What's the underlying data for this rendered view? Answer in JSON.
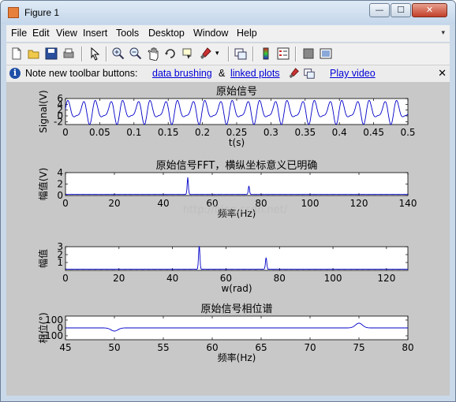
{
  "window": {
    "title": "Figure 1"
  },
  "caption_buttons": {
    "minimize": "—",
    "maximize": "☐",
    "close": "✕"
  },
  "menu": [
    "File",
    "Edit",
    "View",
    "Insert",
    "Tools",
    "Desktop",
    "Window",
    "Help"
  ],
  "toolbar_icons": [
    "new-figure-icon",
    "open-file-icon",
    "save-icon",
    "print-icon",
    "pointer-icon",
    "zoom-in-icon",
    "zoom-out-icon",
    "pan-icon",
    "rotate-3d-icon",
    "data-cursor-icon",
    "brush-icon",
    "link-plot-icon",
    "colorbar-icon",
    "legend-icon",
    "hide-plot-tools-icon",
    "show-plot-tools-icon"
  ],
  "infobar": {
    "prefix": "Note new toolbar buttons:",
    "link1": "data brushing",
    "amp": "&",
    "link2": "linked plots",
    "link3": "Play video",
    "close": "✕"
  },
  "watermark": "http://blog.csdn.net/",
  "colors": {
    "line": "#0000c8",
    "figure_bg": "#c8c8c8",
    "axes_bg": "#ffffff",
    "link": "#0000d8"
  },
  "chart_data": [
    {
      "type": "line",
      "title": "原始信号",
      "xlabel": "t(s)",
      "ylabel": "Signal(V)",
      "xlim": [
        0,
        0.5
      ],
      "ylim": [
        -3,
        6
      ],
      "xticks": [
        "0",
        "0.05",
        "0.1",
        "0.15",
        "0.2",
        "0.25",
        "0.3",
        "0.35",
        "0.4",
        "0.45",
        "0.5"
      ],
      "yticks": [
        "-2",
        "0",
        "2",
        "4",
        "6"
      ],
      "series": [
        {
          "signal": "oscillating signal with ~50 Hz and ~75 Hz components, ranging roughly -2 to 5",
          "freqs_hz": [
            50,
            75
          ],
          "amplitudes": [
            3,
            1.5
          ],
          "offset": 1.5
        }
      ]
    },
    {
      "type": "line",
      "title": "原始信号FFT，横纵坐标意义已明确",
      "xlabel": "频率(Hz)",
      "ylabel": "幅值(V)",
      "xlim": [
        0,
        140
      ],
      "ylim": [
        0,
        4
      ],
      "xticks": [
        "0",
        "20",
        "40",
        "60",
        "80",
        "100",
        "120",
        "140"
      ],
      "yticks": [
        "0",
        "2",
        "4"
      ],
      "peaks": [
        {
          "x": 50,
          "y": 3
        },
        {
          "x": 75,
          "y": 1.5
        }
      ]
    },
    {
      "type": "line",
      "title": "",
      "xlabel": "w(rad)",
      "ylabel": "幅值",
      "xlim": [
        0,
        128
      ],
      "ylim": [
        0,
        3
      ],
      "xticks": [
        "0",
        "20",
        "40",
        "60",
        "80",
        "100",
        "120"
      ],
      "yticks": [
        "1",
        "2",
        "3"
      ],
      "peaks": [
        {
          "x": 50,
          "y": 3
        },
        {
          "x": 75,
          "y": 1.5
        }
      ]
    },
    {
      "type": "line",
      "title": "原始信号相位谱",
      "xlabel": "频率(Hz)",
      "ylabel": "相位(°)",
      "xlim": [
        45,
        80
      ],
      "ylim": [
        -150,
        150
      ],
      "xticks": [
        "45",
        "50",
        "55",
        "60",
        "65",
        "70",
        "75",
        "80"
      ],
      "yticks": [
        "-100",
        "0",
        "100"
      ],
      "events": [
        {
          "x": 50,
          "y": -40
        },
        {
          "x": 75,
          "y": 60
        }
      ]
    }
  ]
}
